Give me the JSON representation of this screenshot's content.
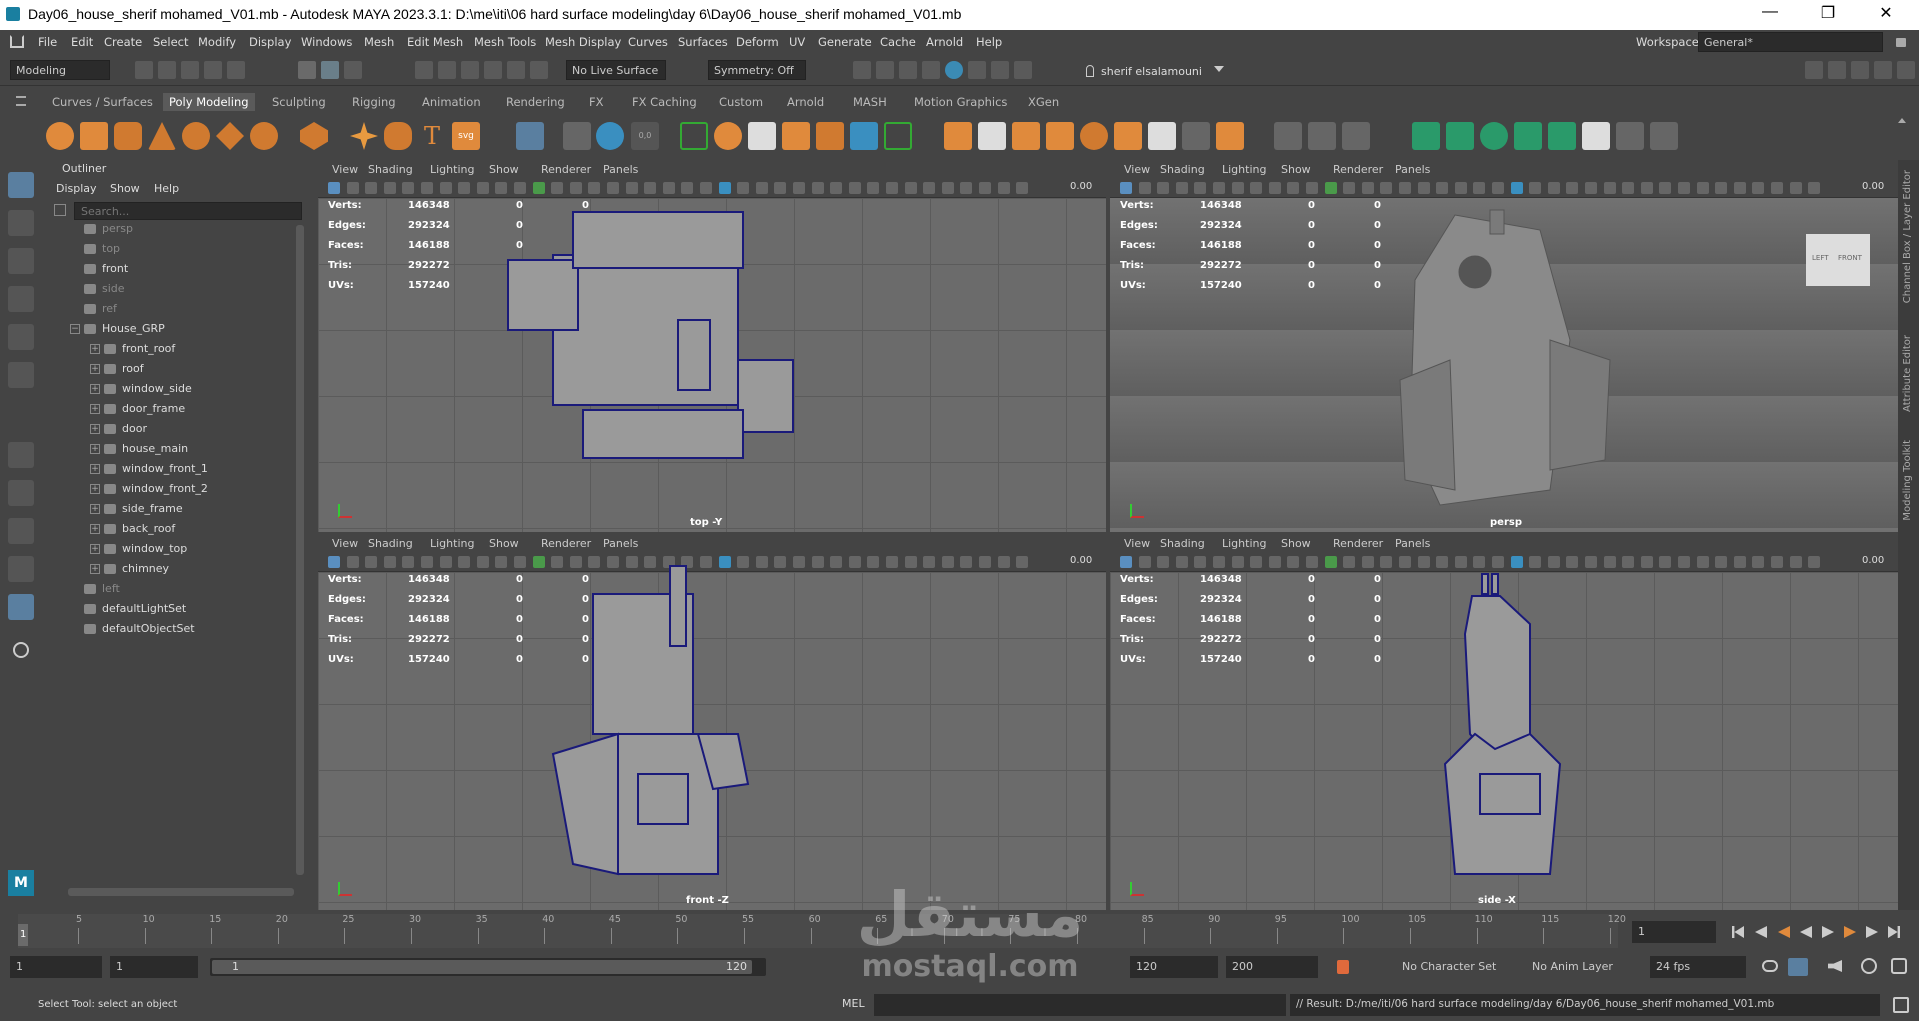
{
  "window": {
    "title": "Day06_house_sherif mohamed_V01.mb - Autodesk MAYA 2023.3.1: D:\\me\\iti\\06 hard surface modeling\\day 6\\Day06_house_sherif mohamed_V01.mb",
    "minimize": "—",
    "maximize": "❐",
    "close": "✕"
  },
  "menu": [
    "File",
    "Edit",
    "Create",
    "Select",
    "Modify",
    "Display",
    "Windows",
    "Mesh",
    "Edit Mesh",
    "Mesh Tools",
    "Mesh Display",
    "Curves",
    "Surfaces",
    "Deform",
    "UV",
    "Generate",
    "Cache",
    "Arnold",
    "Help"
  ],
  "workspace": {
    "label": "Workspace:",
    "value": "General*"
  },
  "status": {
    "mode": "Modeling",
    "live_surface": "No Live Surface",
    "symmetry": "Symmetry: Off",
    "user": "sherif elsalamouni"
  },
  "shelf_tabs": [
    "Curves / Surfaces",
    "Poly Modeling",
    "Sculpting",
    "Rigging",
    "Animation",
    "Rendering",
    "FX",
    "FX Caching",
    "Custom",
    "Arnold",
    "MASH",
    "Motion Graphics",
    "XGen"
  ],
  "shelf_active": "Poly Modeling",
  "outliner": {
    "title": "Outliner",
    "menu": [
      "Display",
      "Show",
      "Help"
    ],
    "search_placeholder": "Search...",
    "items": [
      {
        "label": "persp",
        "dim": true,
        "indent": 1
      },
      {
        "label": "top",
        "dim": true,
        "indent": 1
      },
      {
        "label": "front",
        "dim": false,
        "indent": 1
      },
      {
        "label": "side",
        "dim": true,
        "indent": 1
      },
      {
        "label": "ref",
        "dim": true,
        "indent": 1
      },
      {
        "label": "House_GRP",
        "dim": false,
        "indent": 0,
        "expand": "−"
      },
      {
        "label": "front_roof",
        "dim": false,
        "indent": 2,
        "expand": "+"
      },
      {
        "label": "roof",
        "dim": false,
        "indent": 2,
        "expand": "+"
      },
      {
        "label": "window_side",
        "dim": false,
        "indent": 2,
        "expand": "+"
      },
      {
        "label": "door_frame",
        "dim": false,
        "indent": 2,
        "expand": "+"
      },
      {
        "label": "door",
        "dim": false,
        "indent": 2,
        "expand": "+"
      },
      {
        "label": "house_main",
        "dim": false,
        "indent": 2,
        "expand": "+"
      },
      {
        "label": "window_front_1",
        "dim": false,
        "indent": 2,
        "expand": "+"
      },
      {
        "label": "window_front_2",
        "dim": false,
        "indent": 2,
        "expand": "+"
      },
      {
        "label": "side_frame",
        "dim": false,
        "indent": 2,
        "expand": "+"
      },
      {
        "label": "back_roof",
        "dim": false,
        "indent": 2,
        "expand": "+"
      },
      {
        "label": "window_top",
        "dim": false,
        "indent": 2,
        "expand": "+"
      },
      {
        "label": "chimney",
        "dim": false,
        "indent": 2,
        "expand": "+"
      },
      {
        "label": "left",
        "dim": true,
        "indent": 1
      },
      {
        "label": "defaultLightSet",
        "dim": false,
        "indent": 1
      },
      {
        "label": "defaultObjectSet",
        "dim": false,
        "indent": 1
      }
    ]
  },
  "viewport_menu": [
    "View",
    "Shading",
    "Lighting",
    "Show",
    "Renderer",
    "Panels"
  ],
  "viewport_field": "0.00",
  "hud": [
    {
      "label": "Verts:",
      "v": "146348",
      "a": "0",
      "b": "0"
    },
    {
      "label": "Edges:",
      "v": "292324",
      "a": "0",
      "b": "0"
    },
    {
      "label": "Faces:",
      "v": "146188",
      "a": "0",
      "b": "0"
    },
    {
      "label": "Tris:",
      "v": "292272",
      "a": "0",
      "b": "0"
    },
    {
      "label": "UVs:",
      "v": "157240",
      "a": "0",
      "b": "0"
    }
  ],
  "viewports": {
    "tl": "top -Y",
    "tr": "persp",
    "bl": "front -Z",
    "br": "side -X"
  },
  "viewcube": {
    "left": "LEFT",
    "front": "FRONT"
  },
  "right_panels": [
    "Channel Box / Layer Editor",
    "Attribute Editor",
    "Modeling Toolkit"
  ],
  "timeline": {
    "ticks": [
      "5",
      "10",
      "15",
      "20",
      "25",
      "30",
      "35",
      "40",
      "45",
      "50",
      "55",
      "60",
      "65",
      "70",
      "75",
      "80",
      "85",
      "90",
      "95",
      "100",
      "105",
      "110",
      "115",
      "120"
    ],
    "start_marker": "1",
    "current": "1"
  },
  "range": {
    "start": "1",
    "start2": "1",
    "slider_left": "1",
    "slider_right": "120",
    "end": "120",
    "end2": "200",
    "character_set": "No Character Set",
    "anim_layer": "No Anim Layer",
    "fps": "24 fps"
  },
  "cmd": {
    "help": "Select Tool: select an object",
    "lang": "MEL",
    "result": "// Result: D:/me/iti/06 hard surface modeling/day 6/Day06_house_sherif mohamed_V01.mb"
  },
  "watermark": {
    "arabic": "مستقل",
    "latin": "mostaql.com"
  }
}
